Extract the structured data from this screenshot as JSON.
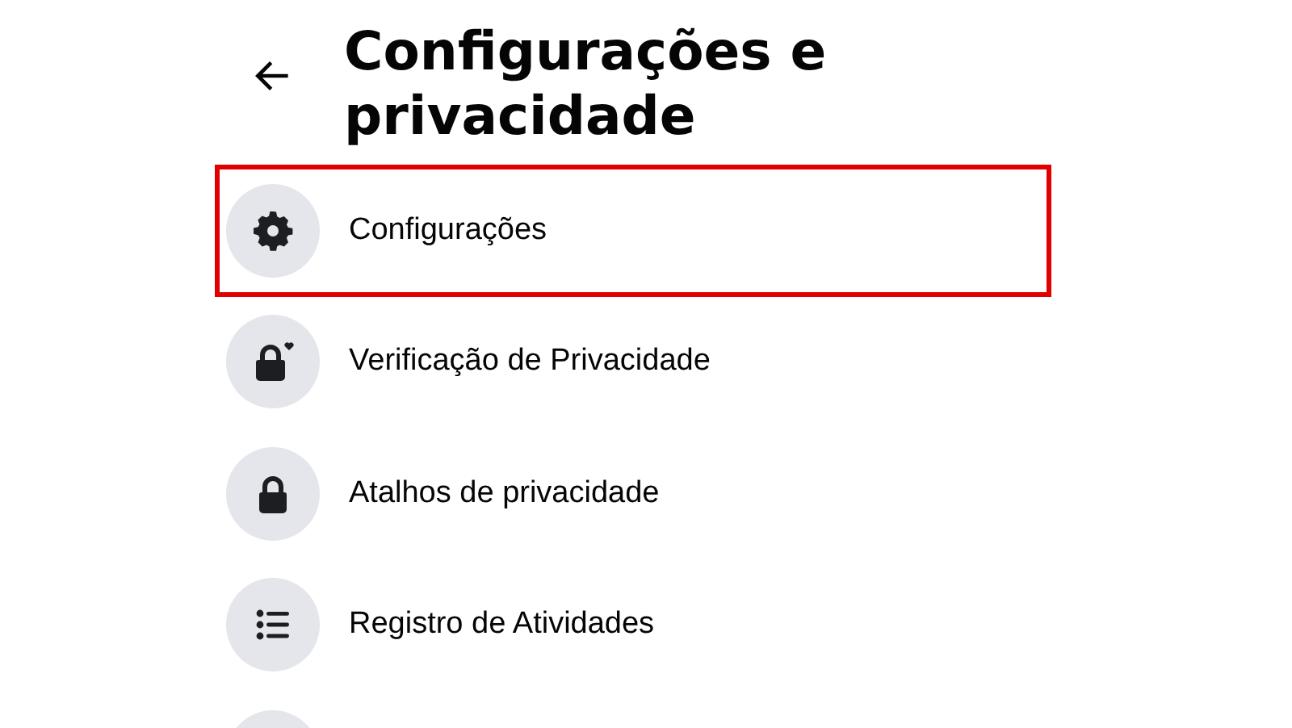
{
  "header": {
    "title": "Configurações e privacidade"
  },
  "items": [
    {
      "kind": "gear",
      "label": "Configurações",
      "highlighted": true
    },
    {
      "kind": "padlock-heart",
      "label": "Verificação de Privacidade",
      "highlighted": false
    },
    {
      "kind": "padlock",
      "label": "Atalhos de privacidade",
      "highlighted": false
    },
    {
      "kind": "list",
      "label": "Registro de Atividades",
      "highlighted": false
    },
    {
      "kind": "partial",
      "highlighted": false
    }
  ]
}
